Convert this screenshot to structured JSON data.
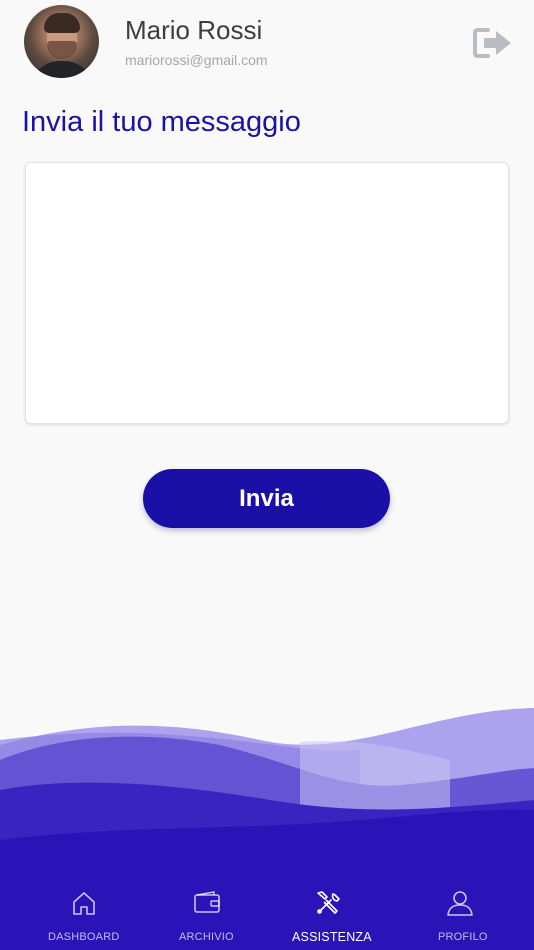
{
  "user": {
    "name": "Mario Rossi",
    "email": "mariorossi@gmail.com"
  },
  "header": {
    "logout_icon": "logout-icon"
  },
  "page": {
    "title": "Invia il tuo messaggio"
  },
  "message": {
    "value": "",
    "placeholder": ""
  },
  "actions": {
    "send_label": "Invia"
  },
  "tabs": [
    {
      "label": "DASHBOARD",
      "icon": "home-icon",
      "active": false
    },
    {
      "label": "ARCHIVIO",
      "icon": "wallet-icon",
      "active": false
    },
    {
      "label": "ASSISTENZA",
      "icon": "tools-icon",
      "active": true
    },
    {
      "label": "PROFILO",
      "icon": "user-icon",
      "active": false
    }
  ],
  "colors": {
    "accent": "#1a0fa6",
    "title": "#1a12a4",
    "background": "#f9f9f9",
    "wave_dark": "#2a14b8",
    "wave_light": "#a89bf0"
  }
}
